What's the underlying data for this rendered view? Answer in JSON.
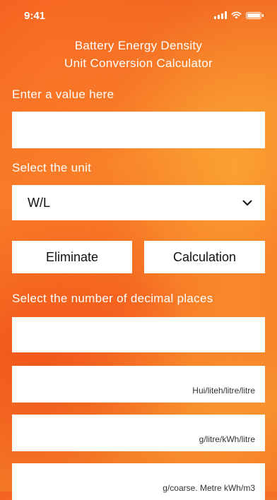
{
  "status": {
    "time": "9:41"
  },
  "title": {
    "line1": "Battery Energy Density",
    "line2": "Unit Conversion Calculator"
  },
  "input": {
    "label": "Enter a value here",
    "value": "",
    "placeholder": ""
  },
  "unit": {
    "label": "Select the unit",
    "selected": "W/L"
  },
  "buttons": {
    "eliminate": "Eliminate",
    "calculate": "Calculation"
  },
  "decimals": {
    "label": "Select the number of decimal places",
    "value": ""
  },
  "results": [
    {
      "unit": "Hui/liteh/litre/litre"
    },
    {
      "unit": "g/litre/kWh/litre"
    },
    {
      "unit": "g/coarse. Metre kWh/m3"
    }
  ]
}
